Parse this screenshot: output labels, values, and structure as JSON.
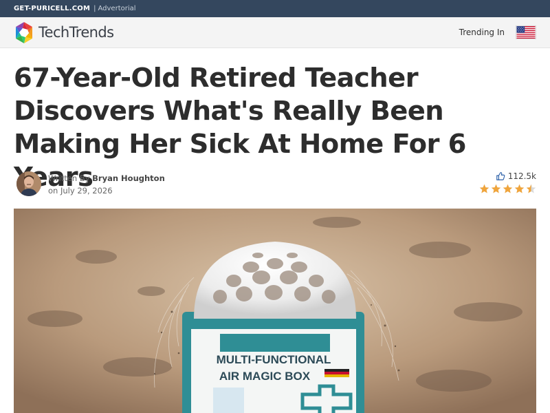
{
  "topbar": {
    "site": "GET-PURICELL.COM",
    "separator": "|",
    "label": "Advertorial"
  },
  "header": {
    "logo_text": "TechTrends",
    "logo_icon": "camera-aperture-logo-icon",
    "trending_label": "Trending In",
    "flag_icon": "us-flag-icon"
  },
  "article": {
    "headline": "67-Year-Old Retired Teacher Discovers What's Really Been Making Her Sick At Home For 6 Years",
    "written_by_label": "Written By",
    "author": "Bryan Houghton",
    "date_label": "on",
    "date": "July 29, 2026",
    "likes": "112.5k",
    "rating": 4.5,
    "rating_max": 5
  },
  "hero_image": {
    "product_label_line1": "MULTI-FUNCTIONAL",
    "product_label_line2": "AIR MAGIC BOX"
  },
  "colors": {
    "topbar_bg": "#34475e",
    "header_bg": "#f4f4f4",
    "star": "#f0a53c",
    "like_icon": "#2b5fa8"
  }
}
